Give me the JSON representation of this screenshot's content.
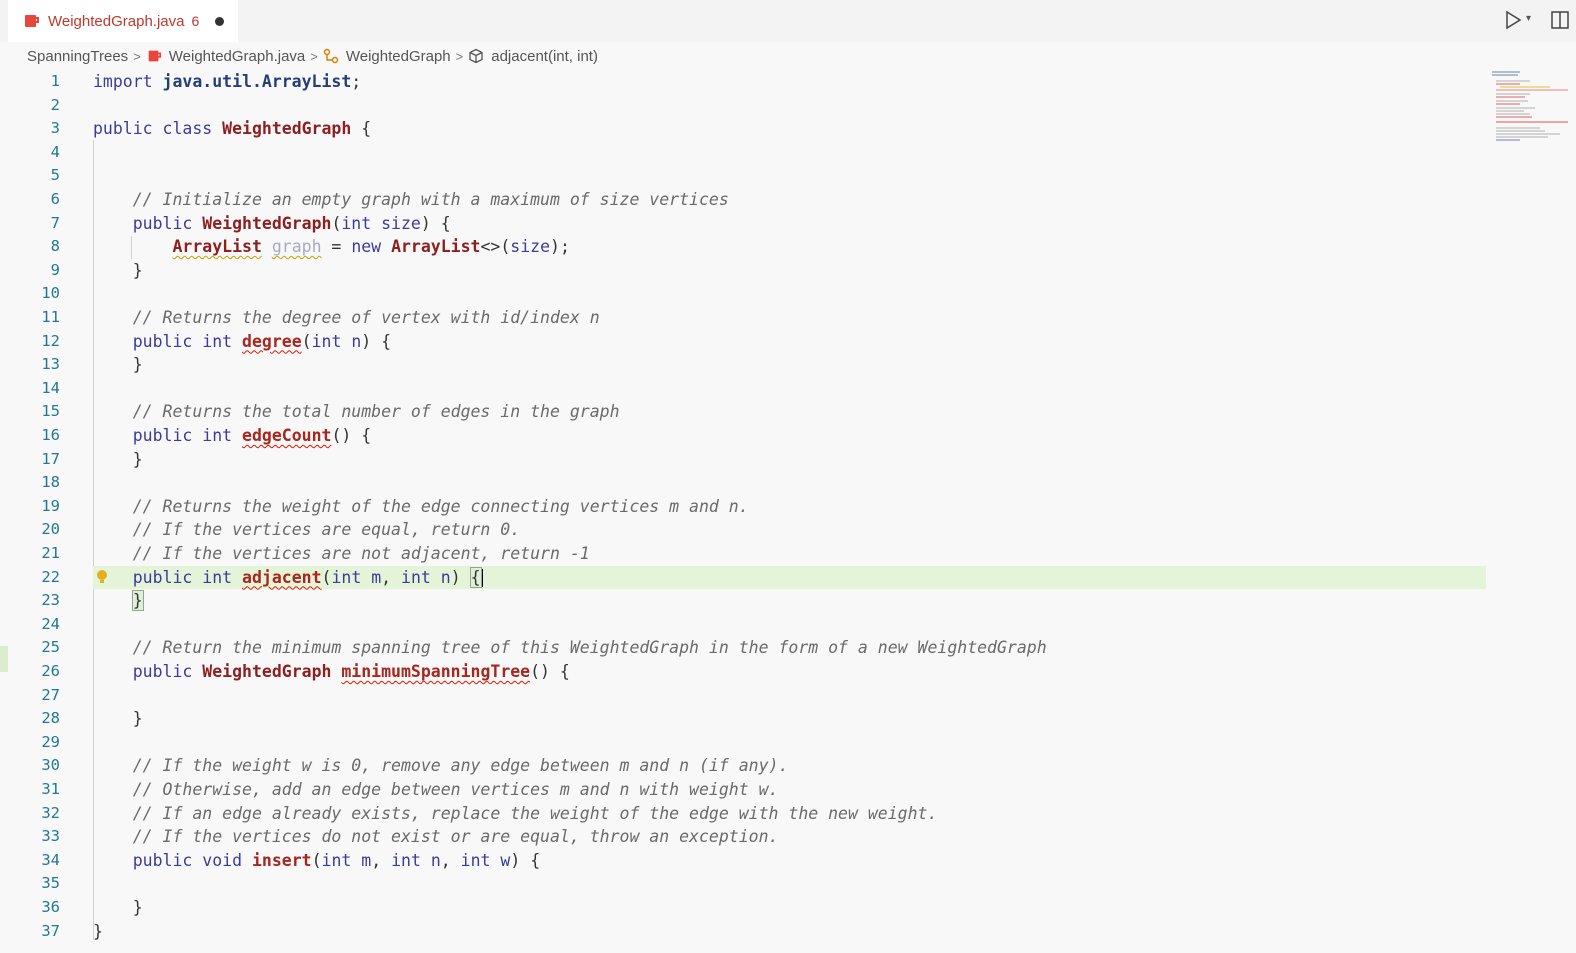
{
  "tab": {
    "filename": "WeightedGraph.java",
    "problem_count": "6",
    "modified": true
  },
  "breadcrumb": {
    "folder": "SpanningTrees",
    "file": "WeightedGraph.java",
    "class": "WeightedGraph",
    "method": "adjacent(int, int)"
  },
  "colors": {
    "accent": "#c0392b",
    "line_highlight": "#e4f4d8",
    "line_number": "#237893"
  },
  "icons": [
    "java-file-icon",
    "run-icon",
    "chevron-down-icon",
    "split-editor-icon",
    "class-icon",
    "method-icon",
    "lightbulb-icon"
  ],
  "code": {
    "active_line": 22,
    "lines": [
      {
        "n": "1",
        "t": "import java.util.ArrayList;"
      },
      {
        "n": "2",
        "t": ""
      },
      {
        "n": "3",
        "t": "public class WeightedGraph {"
      },
      {
        "n": "4",
        "t": ""
      },
      {
        "n": "5",
        "t": ""
      },
      {
        "n": "6",
        "t": "    // Initialize an empty graph with a maximum of size vertices"
      },
      {
        "n": "7",
        "t": "    public WeightedGraph(int size) {"
      },
      {
        "n": "8",
        "t": "        ArrayList graph = new ArrayList<>(size);"
      },
      {
        "n": "9",
        "t": "    }"
      },
      {
        "n": "10",
        "t": ""
      },
      {
        "n": "11",
        "t": "    // Returns the degree of vertex with id/index n"
      },
      {
        "n": "12",
        "t": "    public int degree(int n) {"
      },
      {
        "n": "13",
        "t": "    }"
      },
      {
        "n": "14",
        "t": ""
      },
      {
        "n": "15",
        "t": "    // Returns the total number of edges in the graph"
      },
      {
        "n": "16",
        "t": "    public int edgeCount() {"
      },
      {
        "n": "17",
        "t": "    }"
      },
      {
        "n": "18",
        "t": ""
      },
      {
        "n": "19",
        "t": "    // Returns the weight of the edge connecting vertices m and n."
      },
      {
        "n": "20",
        "t": "    // If the vertices are equal, return 0."
      },
      {
        "n": "21",
        "t": "    // If the vertices are not adjacent, return -1"
      },
      {
        "n": "22",
        "t": "    public int adjacent(int m, int n) {"
      },
      {
        "n": "23",
        "t": "    }"
      },
      {
        "n": "24",
        "t": ""
      },
      {
        "n": "25",
        "t": "    // Return the minimum spanning tree of this WeightedGraph in the form of a new WeightedGraph"
      },
      {
        "n": "26",
        "t": "    public WeightedGraph minimumSpanningTree() {"
      },
      {
        "n": "27",
        "t": ""
      },
      {
        "n": "28",
        "t": "    }"
      },
      {
        "n": "29",
        "t": ""
      },
      {
        "n": "30",
        "t": "    // If the weight w is 0, remove any edge between m and n (if any)."
      },
      {
        "n": "31",
        "t": "    // Otherwise, add an edge between vertices m and n with weight w."
      },
      {
        "n": "32",
        "t": "    // If an edge already exists, replace the weight of the edge with the new weight."
      },
      {
        "n": "33",
        "t": "    // If the vertices do not exist or are equal, throw an exception."
      },
      {
        "n": "34",
        "t": "    public void insert(int m, int n, int w) {"
      },
      {
        "n": "35",
        "t": ""
      },
      {
        "n": "36",
        "t": "    }"
      },
      {
        "n": "37",
        "t": "}"
      }
    ]
  }
}
